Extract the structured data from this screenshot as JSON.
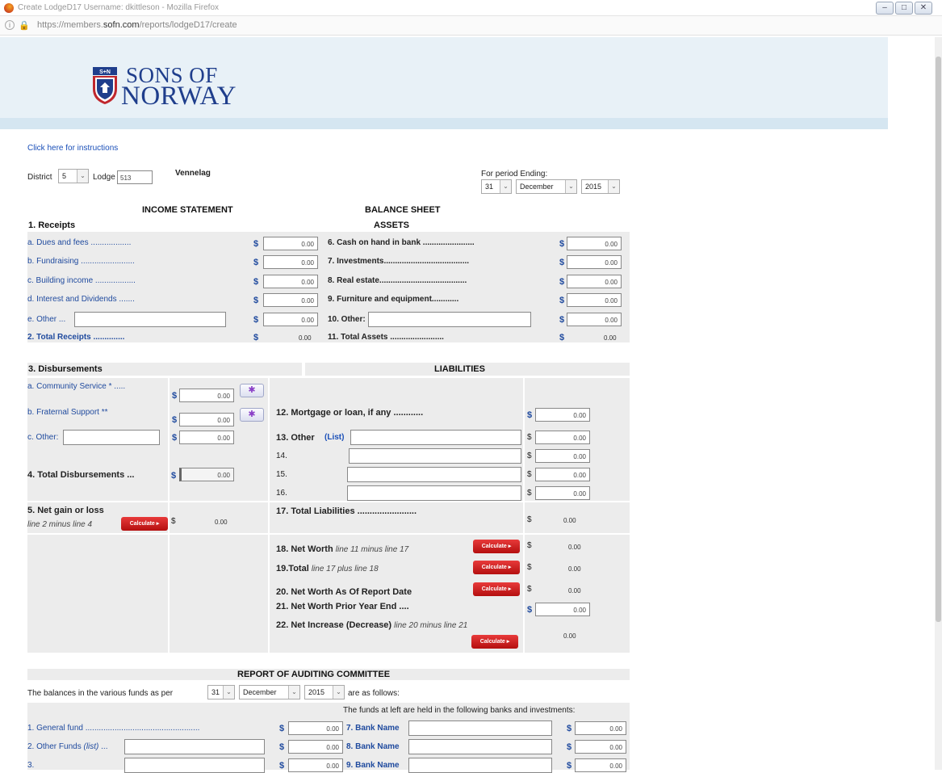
{
  "window": {
    "title": "Create LodgeD17 Username: dkittleson - Mozilla Firefox",
    "url_prefix": "https://members.",
    "url_domain": "sofn.com",
    "url_path": "/reports/lodgeD17/create",
    "min": "–",
    "max": "□",
    "close": "✕"
  },
  "logo": {
    "line1": "SONS OF",
    "line2": "NORWAY",
    "crest": "S+N"
  },
  "instructions_link": "Click here for instructions",
  "district": {
    "label": "District",
    "value": "5"
  },
  "lodge": {
    "label": "Lodge",
    "value": "513",
    "name": "Vennelag"
  },
  "period": {
    "label": "For period Ending:",
    "day": "31",
    "month": "December",
    "year": "2015"
  },
  "income": {
    "title": "INCOME STATEMENT",
    "receipts_title": "1. Receipts",
    "a": "a. Dues and fees ..................",
    "a_val": "0.00",
    "b": "b. Fundraising ........................",
    "b_val": "0.00",
    "c": "c. Building income ..................",
    "c_val": "0.00",
    "d": "d. Interest and Dividends .......",
    "d_val": "0.00",
    "e": "e. Other ...",
    "e_val": "0.00",
    "total": "2. Total Receipts ..............",
    "total_val": "0.00",
    "disb_title": "3. Disbursements",
    "da": "a. Community Service * .....",
    "da_val": "0.00",
    "db": "b. Fraternal Support **",
    "db_val": "0.00",
    "dc": "c. Other:",
    "dc_val": "0.00",
    "dtotal": "4. Total Disbursements ...",
    "dtotal_val": "0.00",
    "net": "5. Net gain or loss",
    "net_sub": "line 2 minus line 4",
    "net_val": "0.00"
  },
  "balance": {
    "title": "BALANCE SHEET",
    "assets_title": "ASSETS",
    "a6": "6. Cash on hand in bank .......................",
    "a6_val": "0.00",
    "a7": "7. Investments......................................",
    "a7_val": "0.00",
    "a8": "8. Real estate.......................................",
    "a8_val": "0.00",
    "a9": "9. Furniture and equipment............",
    "a9_val": "0.00",
    "a10": "10. Other:",
    "a10_val": "0.00",
    "a11": "11. Total Assets ........................",
    "a11_val": "0.00",
    "liab_title": "LIABILITIES",
    "l12": "12. Mortgage or loan, if any ............",
    "l12_val": "0.00",
    "l13": "13. Other",
    "l13_list": "(List)",
    "l13_val": "0.00",
    "l14": "14.",
    "l14_val": "0.00",
    "l15": "15.",
    "l15_val": "0.00",
    "l16": "16.",
    "l16_val": "0.00",
    "l17": "17. Total Liabilities ........................",
    "l17_val": "0.00",
    "l18": "18. Net Worth",
    "l18_sub": "line 11 minus line 17",
    "l18_val": "0.00",
    "l19": "19.Total",
    "l19_sub": "line 17 plus line 18",
    "l19_val": "0.00",
    "l20": "20. Net Worth As Of Report Date",
    "l20_val": "0.00",
    "l21": "21. Net Worth Prior Year End ....",
    "l21_val": "0.00",
    "l22": "22. Net Increase (Decrease)",
    "l22_sub": "line 20 minus line 21",
    "l22_val": "0.00"
  },
  "buttons": {
    "calculate": "Calculate ▸",
    "star": "✱"
  },
  "currency": "$",
  "dropdown_arrow": "⌄",
  "audit": {
    "title": "REPORT OF AUDITING COMMITTEE",
    "text1": "The balances in the various funds as per",
    "day": "31",
    "month": "December",
    "year": "2015",
    "text2": "are as follows:",
    "held": "The funds at left are held in the following banks and investments:",
    "f1": "1. General fund ...................................................",
    "f1_val": "0.00",
    "f2": "2. Other Funds",
    "f2_list": "(list)",
    "f2_dots": "...",
    "f2_val": "0.00",
    "f3": "3.",
    "f3_val": "0.00",
    "b7": "7. Bank Name",
    "b7_val": "0.00",
    "b8": "8. Bank Name",
    "b8_val": "0.00",
    "b9": "9. Bank Name",
    "b9_val": "0.00"
  }
}
